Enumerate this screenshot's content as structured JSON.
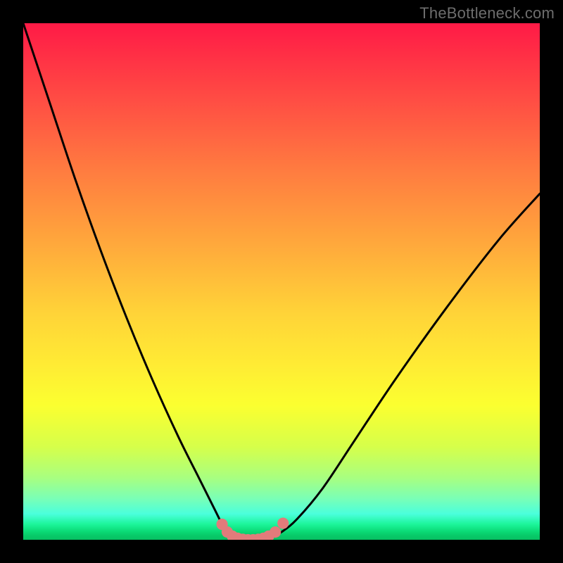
{
  "watermark": "TheBottleneck.com",
  "chart_data": {
    "type": "line",
    "title": "",
    "xlabel": "",
    "ylabel": "",
    "xlim": [
      0,
      100
    ],
    "ylim": [
      0,
      100
    ],
    "grid": false,
    "legend": false,
    "description": "V-shaped bottleneck curve on red-to-green gradient; minimum plateau around x≈40–48 at y≈0, rising steeply to both sides. A cluster of pink dots sits along the flat bottom.",
    "series": [
      {
        "name": "bottleneck-curve",
        "color": "#000000",
        "x": [
          0,
          5,
          10,
          15,
          20,
          25,
          30,
          34,
          37,
          39,
          40,
          42,
          44,
          46,
          48,
          50,
          53,
          58,
          64,
          72,
          82,
          92,
          100
        ],
        "y": [
          100,
          85,
          70,
          56,
          43,
          31,
          20,
          12,
          6,
          2,
          0.5,
          0,
          0,
          0,
          0.5,
          1.5,
          4,
          10,
          19,
          31,
          45,
          58,
          67
        ]
      }
    ],
    "dots": {
      "name": "minimum-cluster",
      "color": "#e27b7b",
      "radius": 1.1,
      "points": [
        {
          "x": 38.5,
          "y": 3.0
        },
        {
          "x": 39.5,
          "y": 1.5
        },
        {
          "x": 40.5,
          "y": 0.7
        },
        {
          "x": 41.5,
          "y": 0.3
        },
        {
          "x": 42.5,
          "y": 0.1
        },
        {
          "x": 43.5,
          "y": 0.0
        },
        {
          "x": 44.5,
          "y": 0.0
        },
        {
          "x": 45.5,
          "y": 0.1
        },
        {
          "x": 46.5,
          "y": 0.3
        },
        {
          "x": 47.5,
          "y": 0.7
        },
        {
          "x": 48.8,
          "y": 1.5
        },
        {
          "x": 50.3,
          "y": 3.2
        }
      ]
    }
  }
}
